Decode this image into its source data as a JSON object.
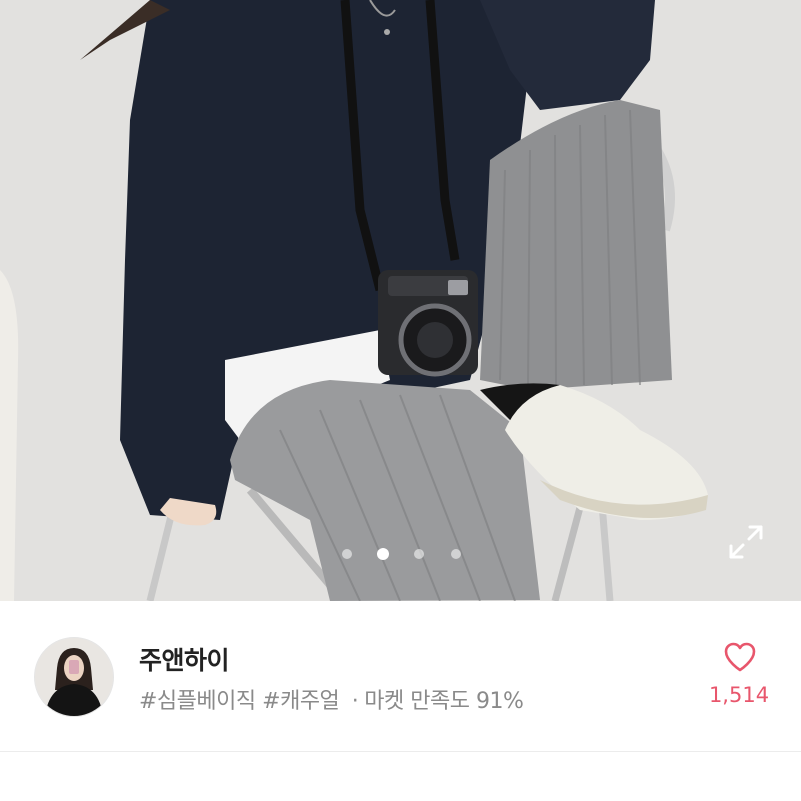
{
  "product_image": {
    "alt": "",
    "slide_count": 4,
    "active_slide": 2
  },
  "shop": {
    "name": "주앤하이",
    "tag1": "#심플베이직",
    "tag2": "#캐주얼",
    "separator": "·",
    "satisfaction": "마켓 만족도 91%"
  },
  "like": {
    "count": "1,514",
    "icon": "heart-outline-icon"
  },
  "colors": {
    "accent_pink": "#e8566c",
    "text_dark": "#222222",
    "text_gray": "#8a8a8a"
  },
  "icons": {
    "expand": "expand-icon"
  },
  "bottom_text": ""
}
